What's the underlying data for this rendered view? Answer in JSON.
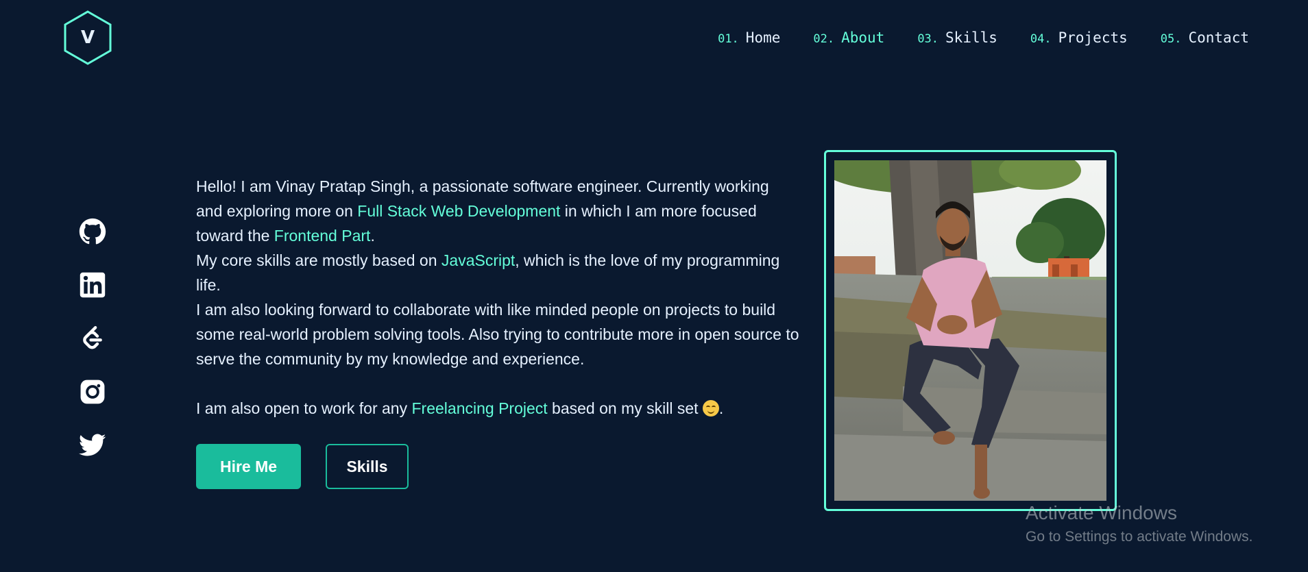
{
  "logo": {
    "letter": "V"
  },
  "nav": {
    "items": [
      {
        "num": "01.",
        "label": "Home",
        "active": false
      },
      {
        "num": "02.",
        "label": "About",
        "active": true
      },
      {
        "num": "03.",
        "label": "Skills",
        "active": false
      },
      {
        "num": "04.",
        "label": "Projects",
        "active": false
      },
      {
        "num": "05.",
        "label": "Contact",
        "active": false
      }
    ]
  },
  "social": {
    "icons": [
      "github-icon",
      "linkedin-icon",
      "leetcode-icon",
      "instagram-icon",
      "twitter-icon"
    ]
  },
  "about": {
    "p1_a": "Hello! I am Vinay Pratap Singh, a passionate software engineer. Currently working and exploring more on ",
    "p1_hl1": "Full Stack Web Development",
    "p1_b": " in which I am more focused toward the ",
    "p1_hl2": "Frontend Part",
    "p1_c": ".",
    "p2_a": "My core skills are mostly based on ",
    "p2_hl": "JavaScript",
    "p2_b": ", which is the love of my programming life.",
    "p3": "I am also looking forward to collaborate with like minded people on projects to build some real-world problem solving tools. Also trying to contribute more in open source to serve the community by my knowledge and experience.",
    "p4_a": "I am also open to work for any ",
    "p4_hl": "Freelancing Project",
    "p4_b": " based on my skill set ",
    "p4_c": "."
  },
  "buttons": {
    "hire": "Hire Me",
    "skills": "Skills"
  },
  "watermark": {
    "title": "Activate Windows",
    "subtitle": "Go to Settings to activate Windows."
  },
  "colors": {
    "background": "#0a192f",
    "accent": "#64ffda",
    "button": "#1abc9c",
    "text": "#e6f1ff"
  }
}
